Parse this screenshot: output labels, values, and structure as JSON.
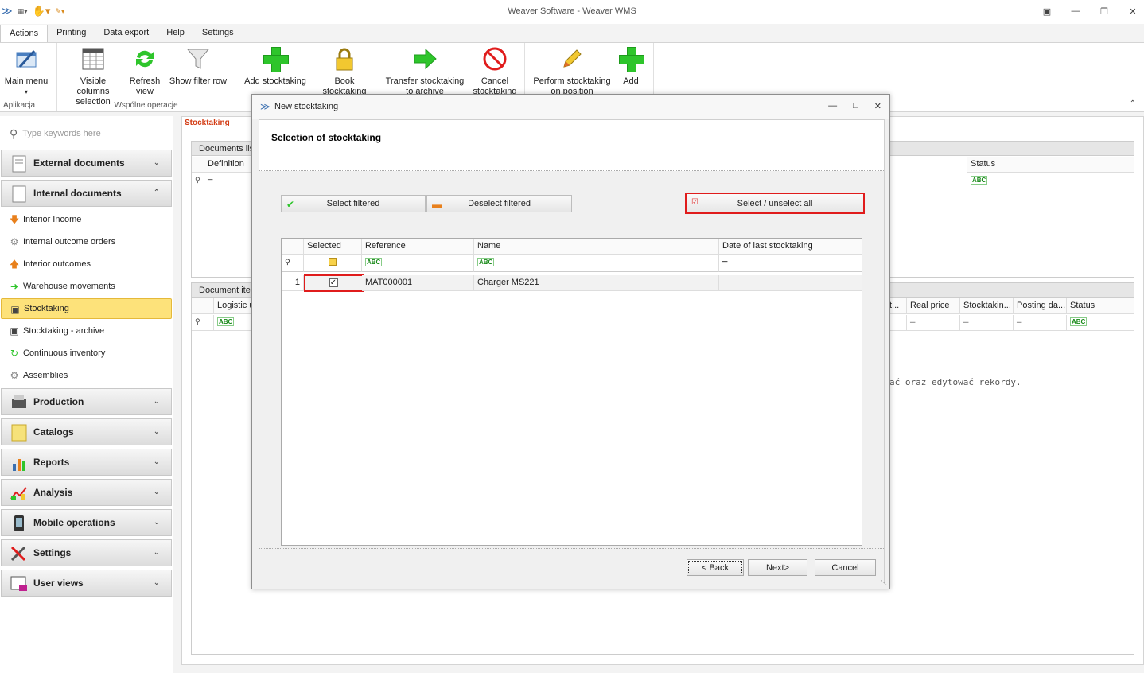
{
  "window": {
    "title": "Weaver Software - Weaver WMS"
  },
  "ribbon_tabs": [
    "Actions",
    "Printing",
    "Data export",
    "Help",
    "Settings"
  ],
  "ribbon": {
    "groups": [
      {
        "label": "Aplikacja",
        "buttons": [
          {
            "label": "Main menu"
          }
        ]
      },
      {
        "label": "Wspólne operacje",
        "buttons": [
          {
            "label": "Visible columns selection"
          },
          {
            "label": "Refresh view"
          },
          {
            "label": "Show filter row"
          }
        ]
      },
      {
        "label": "",
        "buttons": [
          {
            "label": "Add stocktaking"
          },
          {
            "label": "Book stocktaking"
          },
          {
            "label": "Transfer stocktaking to archive"
          },
          {
            "label": "Cancel stocktaking"
          }
        ]
      },
      {
        "label": "",
        "buttons": [
          {
            "label": "Perform stocktaking on position"
          },
          {
            "label": "Add"
          }
        ]
      }
    ]
  },
  "nav": {
    "search_placeholder": "Type keywords here",
    "headers": {
      "external": "External documents",
      "internal": "Internal documents",
      "production": "Production",
      "catalogs": "Catalogs",
      "reports": "Reports",
      "analysis": "Analysis",
      "mobile": "Mobile operations",
      "settings": "Settings",
      "user_views": "User views"
    },
    "internal_items": [
      "Interior Income",
      "Internal outcome orders",
      "Interior outcomes",
      "Warehouse movements",
      "Stocktaking",
      "Stocktaking - archive",
      "Continuous inventory",
      "Assemblies"
    ]
  },
  "main": {
    "breadcrumb": "Stocktaking",
    "documents_panel": {
      "title": "Documents lis",
      "col_definition": "Definition",
      "col_status": "Status"
    },
    "items_panel": {
      "title": "Document iter",
      "col_logistic": "Logistic u",
      "col_t": "t...",
      "col_real_price": "Real price",
      "col_stocktaking": "Stocktakin...",
      "col_posting": "Posting da...",
      "col_status": "Status"
    },
    "empty_message": "ać oraz edytować rekordy."
  },
  "dialog": {
    "title": "New stocktaking",
    "heading": "Selection of stocktaking",
    "btn_select_filtered": "Select filtered",
    "btn_deselect_filtered": "Deselect filtered",
    "btn_select_all": "Select / unselect all",
    "grid": {
      "headers": {
        "selected": "Selected",
        "reference": "Reference",
        "name": "Name",
        "date": "Date of last stocktaking"
      },
      "rows": [
        {
          "num": "1",
          "selected": true,
          "reference": "MAT000001",
          "name": "Charger MS221",
          "date": ""
        }
      ]
    },
    "btn_back": "< Back",
    "btn_next": "Next>",
    "btn_cancel": "Cancel"
  },
  "colors": {
    "accent_red": "#e01c1c",
    "active_nav": "#fde27a",
    "breadcrumb": "#d23a12"
  }
}
